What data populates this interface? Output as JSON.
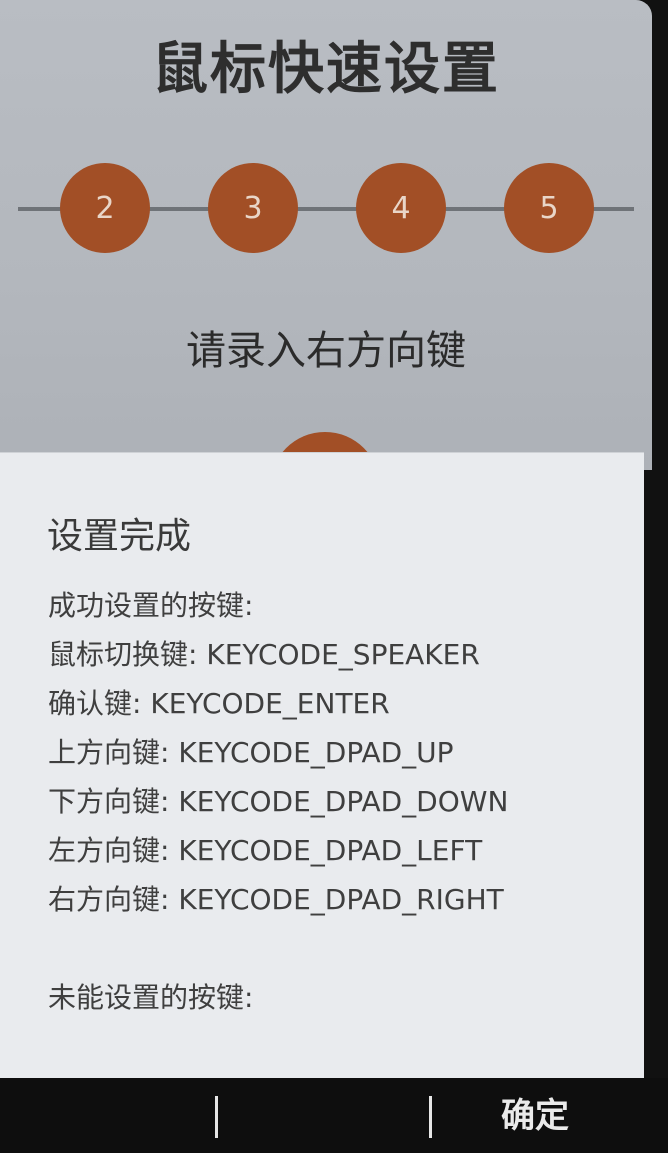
{
  "wizard": {
    "title": "鼠标快速设置",
    "steps": [
      "2",
      "3",
      "4",
      "5"
    ],
    "instruction": "请录入右方向键",
    "accent_color": "#a24f26"
  },
  "dialog": {
    "title": "设置完成",
    "success_header": "成功设置的按键:",
    "success_lines": [
      "鼠标切换键: KEYCODE_SPEAKER",
      "确认键: KEYCODE_ENTER",
      "上方向键: KEYCODE_DPAD_UP",
      "下方向键: KEYCODE_DPAD_DOWN",
      "左方向键: KEYCODE_DPAD_LEFT",
      "右方向键: KEYCODE_DPAD_RIGHT"
    ],
    "failed_header": "未能设置的按键:"
  },
  "softkeys": {
    "left": "",
    "center": "",
    "right": "确定"
  }
}
